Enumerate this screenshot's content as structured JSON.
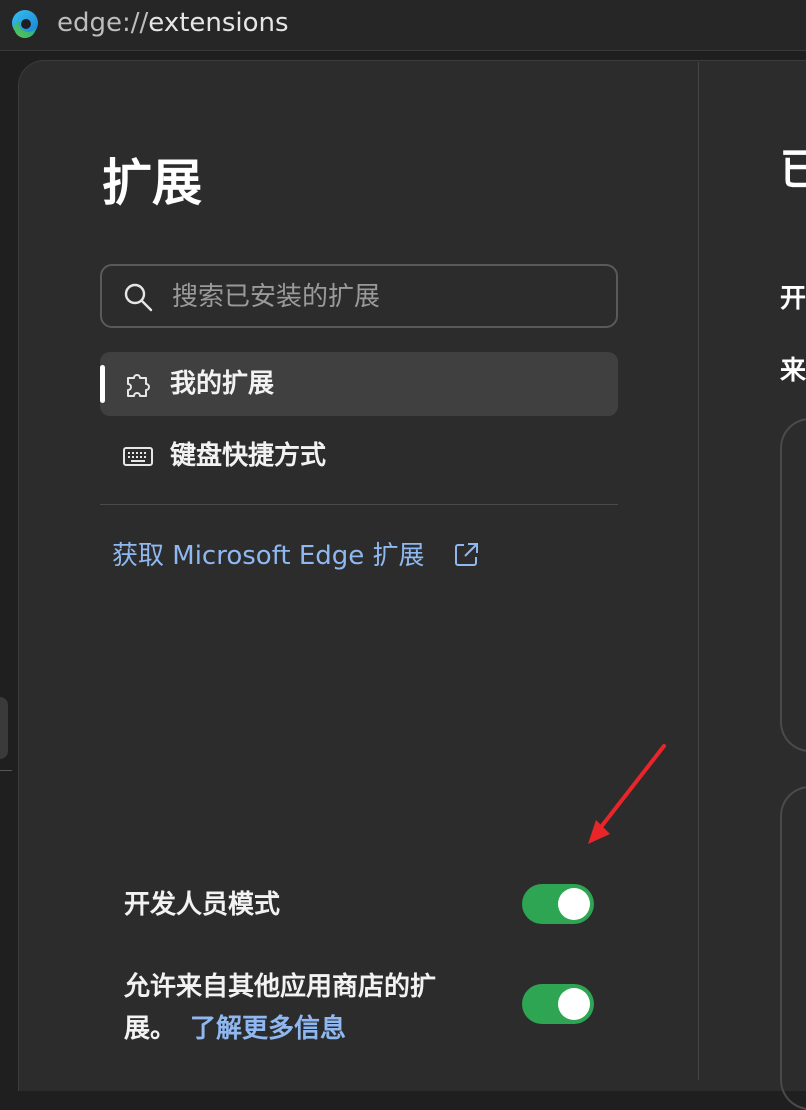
{
  "address_bar": {
    "scheme": "edge://",
    "host": "extensions"
  },
  "sidebar": {
    "title": "扩展",
    "search": {
      "placeholder": "搜索已安装的扩展",
      "value": ""
    },
    "nav_items": [
      {
        "label": "我的扩展",
        "icon": "puzzle-icon",
        "active": true
      },
      {
        "label": "键盘快捷方式",
        "icon": "keyboard-icon",
        "active": false
      }
    ],
    "store_link": "获取 Microsoft Edge 扩展",
    "settings": {
      "developer_mode": {
        "label": "开发人员模式",
        "enabled": true
      },
      "other_stores": {
        "label": "允许来自其他应用商店的扩展。",
        "link": "了解更多信息",
        "enabled": true
      }
    }
  },
  "main": {
    "title": "已",
    "line1": "开",
    "line2": "来"
  },
  "colors": {
    "accent_link": "#8fb8f0",
    "toggle_on": "#2ea553",
    "annotation_arrow": "#e8262a"
  }
}
